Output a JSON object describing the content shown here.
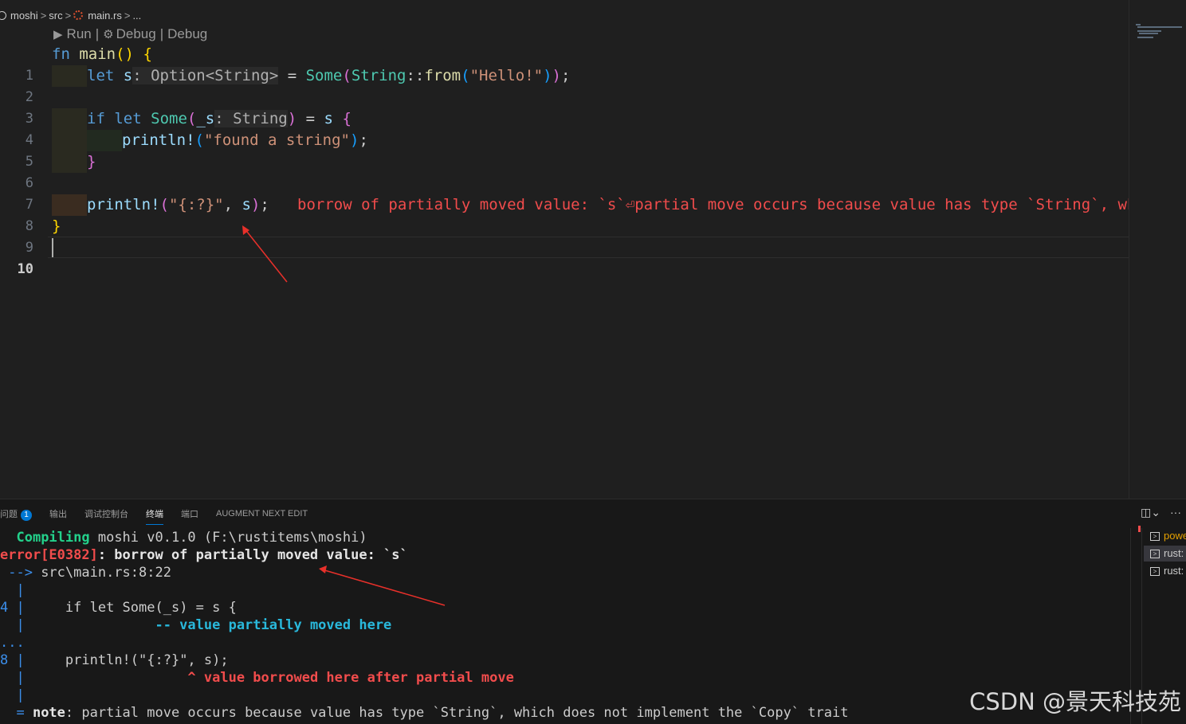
{
  "breadcrumb": {
    "folder": "moshi",
    "sep": ">",
    "src": "src",
    "file": "main.rs",
    "more": "..."
  },
  "codelens": {
    "run": "Run",
    "sep1": "|",
    "debug": "Debug",
    "sep2": "|",
    "debug2": "Debug"
  },
  "editor": {
    "line_numbers": [
      "1",
      "2",
      "3",
      "4",
      "5",
      "6",
      "7",
      "8",
      "9",
      "10"
    ],
    "active_line": "10",
    "code": {
      "l1_fn": "fn",
      "l1_name": "main",
      "l1_parens": "()",
      "l1_brace": "{",
      "l2_let": "let",
      "l2_var": "s",
      "l2_hint": ": Option<String>",
      "l2_eq": " = ",
      "l2_some": "Some",
      "l2_p1": "(",
      "l2_type": "String",
      "l2_colons": "::",
      "l2_from": "from",
      "l2_p2": "(",
      "l2_str": "\"Hello!\"",
      "l2_p3": ")",
      "l2_p4": ")",
      "l2_semi": ";",
      "l4_if": "if",
      "l4_let": "let",
      "l4_some": "Some",
      "l4_p1": "(",
      "l4_var": "_s",
      "l4_hint": ": String",
      "l4_p2": ")",
      "l4_eq": " = ",
      "l4_s": "s",
      "l4_brace": "{",
      "l5_macro": "println!",
      "l5_p1": "(",
      "l5_str": "\"found a string\"",
      "l5_p2": ")",
      "l5_semi": ";",
      "l6_brace": "}",
      "l8_macro": "println!",
      "l8_p1": "(",
      "l8_str": "\"{:?}\"",
      "l8_comma": ", ",
      "l8_var": "s",
      "l8_p2": ")",
      "l8_semi": ";",
      "l9_brace": "}"
    },
    "inline_error": "borrow of partially moved value: `s`⏎partial move occurs because value has type `String`, whic"
  },
  "panel": {
    "tabs": [
      {
        "label": "问题",
        "badge": "1"
      },
      {
        "label": "输出"
      },
      {
        "label": "调试控制台"
      },
      {
        "label": "终端"
      },
      {
        "label": "端口"
      },
      {
        "label": "AUGMENT NEXT EDIT"
      }
    ],
    "active_tab": "终端"
  },
  "terminal": {
    "l1_status": "Compiling",
    "l1_rest": " moshi v0.1.0 (F:\\rustitems\\moshi)",
    "l2_error": "error[E0382]",
    "l2_rest": ": borrow of partially moved value: `s`",
    "l3_arrow": " -->",
    "l3_loc": " src\\main.rs:8:22",
    "l4_bar": "  |",
    "l5_num": "4",
    "l5_bar": " |",
    "l5_code": "     if let Some(_s) = s {",
    "l6_bar": "  |",
    "l6_marker": "                -- value partially moved here",
    "l7_dots": "...",
    "l8_num": "8",
    "l8_bar": " |",
    "l8_code": "     println!(\"{:?}\", s);",
    "l9_bar": "  |",
    "l9_marker": "                    ^ value borrowed here after partial move",
    "l10_bar": "  |",
    "l11_eq": "  =",
    "l11_note": " note",
    "l11_rest": ": partial move occurs because value has type `String`, which does not implement the `Copy` trait"
  },
  "terminal_list": [
    "powe",
    "rust:",
    "rust:"
  ],
  "watermark": "CSDN @景天科技苑",
  "colors": {
    "accent": "#0078d4",
    "error": "#f14c4c",
    "success": "#23d18b"
  }
}
